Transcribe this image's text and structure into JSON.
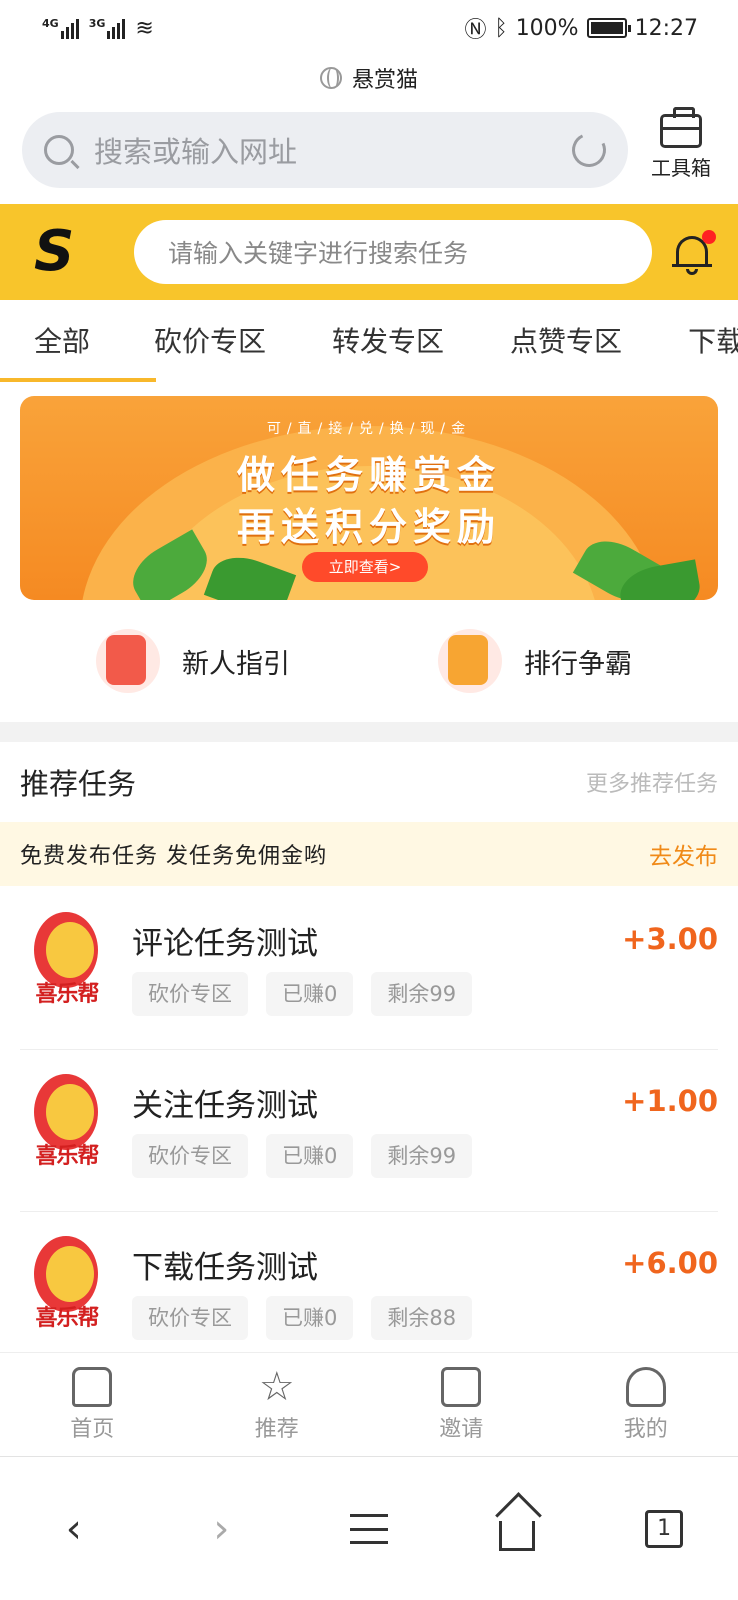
{
  "status_bar": {
    "net1": "4G",
    "net2": "3G",
    "battery": "100%",
    "time": "12:27"
  },
  "browser": {
    "site_title": "悬赏猫",
    "search_placeholder": "搜索或输入网址",
    "toolbox_label": "工具箱"
  },
  "header": {
    "logo": "S",
    "search_placeholder": "请输入关键字进行搜索任务"
  },
  "category_tabs": [
    "全部",
    "砍价专区",
    "转发专区",
    "点赞专区",
    "下载"
  ],
  "banner": {
    "small": "可/直/接/兑/换/现/金",
    "line1": "做任务赚赏金",
    "line2": "再送积分奖励",
    "cta": "立即查看>"
  },
  "shortcuts": [
    {
      "label": "新人指引"
    },
    {
      "label": "排行争霸"
    }
  ],
  "recommended": {
    "title": "推荐任务",
    "more": "更多推荐任务"
  },
  "notice": {
    "text": "免费发布任务 发任务免佣金哟",
    "action": "去发布"
  },
  "avatar_text": "喜乐帮",
  "tasks": [
    {
      "title": "评论任务测试",
      "price": "+3.00",
      "tags": [
        "砍价专区",
        "已赚0",
        "剩余99"
      ]
    },
    {
      "title": "关注任务测试",
      "price": "+1.00",
      "tags": [
        "砍价专区",
        "已赚0",
        "剩余99"
      ]
    },
    {
      "title": "下载任务测试",
      "price": "+6.00",
      "tags": [
        "砍价专区",
        "已赚0",
        "剩余88"
      ]
    }
  ],
  "tabbar": [
    "首页",
    "推荐",
    "邀请",
    "我的"
  ],
  "bottom_nav": {
    "tabs_count": "1"
  },
  "colors": {
    "brand_yellow": "#f8c52b",
    "price_orange": "#f0651d",
    "notice_bg": "#fff8e3"
  }
}
